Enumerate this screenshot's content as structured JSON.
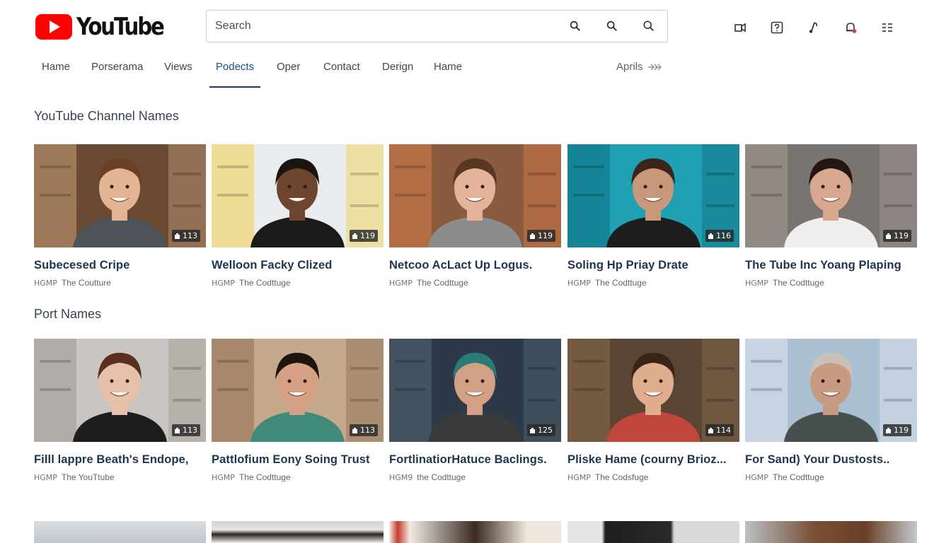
{
  "app": {
    "logo_text": "YouTube",
    "brand_color": "#ff0000"
  },
  "search": {
    "placeholder": "Search",
    "value": "",
    "buttons": [
      "search-icon",
      "search-icon",
      "search-icon"
    ]
  },
  "header_icons": [
    "upload-icon",
    "help-icon",
    "music-icon",
    "notifications-icon",
    "apps-grid-icon"
  ],
  "nav": {
    "tabs": [
      {
        "label": "Hame",
        "active": false
      },
      {
        "label": "Porserama",
        "active": false
      },
      {
        "label": "Views",
        "active": false
      },
      {
        "label": "Podects",
        "active": true
      },
      {
        "label": "Oper",
        "active": false
      },
      {
        "label": "Contact",
        "active": false
      },
      {
        "label": "Derign",
        "active": false
      },
      {
        "label": "Hame",
        "active": false
      }
    ],
    "more_label": "Aprils",
    "more_icon": "double-arrow-right-icon"
  },
  "sections": [
    {
      "title": "YouTube Channel Names",
      "videos": [
        {
          "title": "Subecesed Cripe",
          "tag": "HGMP",
          "channel": "The Coutture",
          "duration": "113"
        },
        {
          "title": "Welloon Facky Clized",
          "tag": "HGMP",
          "channel": "The Codttuge",
          "duration": "119"
        },
        {
          "title": "Netcoo AcLact Up Logus.",
          "tag": "HGMP",
          "channel": "The Codttuge",
          "duration": "119"
        },
        {
          "title": "Soling Hp Priay Drate",
          "tag": "HGMP",
          "channel": "The Codttuge",
          "duration": "116"
        },
        {
          "title": "The Tube Inc Yoang Plaping",
          "tag": "HGMP",
          "channel": "The Codttuge",
          "duration": "119"
        }
      ]
    },
    {
      "title": "Port Names",
      "videos": [
        {
          "title": "Filll lappre Beath's Endope,",
          "tag": "HGMP",
          "channel": "The YouTtube",
          "duration": "113"
        },
        {
          "title": "Pattlofium Eony Soing Trust",
          "tag": "HGMP",
          "channel": "The Codttuge",
          "duration": "113"
        },
        {
          "title": "FortlinatiorHatuce Baclings.",
          "tag": "HGM9",
          "channel": "the Codttuge",
          "duration": "125"
        },
        {
          "title": "Pliske Hame (courny Brioz...",
          "tag": "HGMP",
          "channel": "The Codsfuge",
          "duration": "114"
        },
        {
          "title": "For Sand) Your Dustosts..",
          "tag": "HGMP",
          "channel": "The Codttuge",
          "duration": "119"
        }
      ]
    }
  ]
}
